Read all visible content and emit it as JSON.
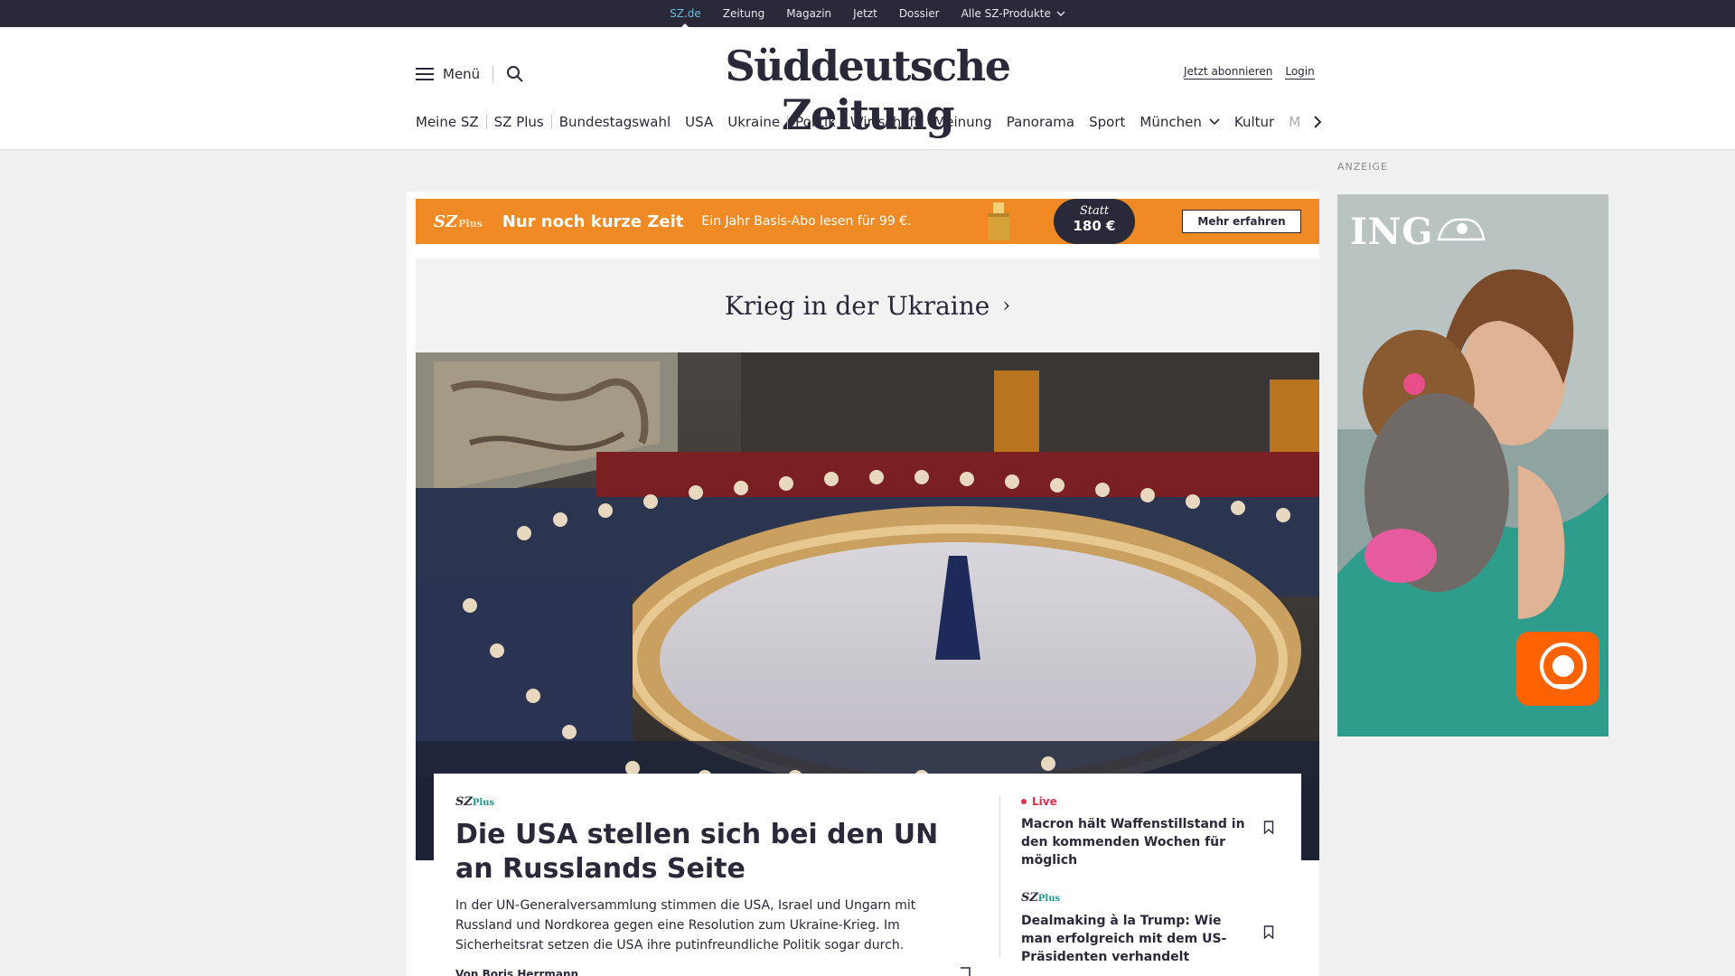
{
  "topbar": {
    "items": [
      {
        "label": "SZ.de",
        "active": true
      },
      {
        "label": "Zeitung"
      },
      {
        "label": "Magazin"
      },
      {
        "label": "Jetzt"
      },
      {
        "label": "Dossier"
      },
      {
        "label": "Alle SZ-Produkte",
        "icon": "chevron-down-icon"
      }
    ]
  },
  "header": {
    "menu_label": "Menü",
    "menu_icon": "hamburger-icon",
    "search_icon": "search-icon",
    "logo": "Süddeutsche Zeitung",
    "subscribe": "Jetzt abonnieren",
    "login": "Login"
  },
  "nav": {
    "items": [
      "Meine SZ",
      "SZ Plus",
      "Bundestagswahl",
      "USA",
      "Ukraine",
      "Politik",
      "Wirtschaft",
      "Meinung",
      "Panorama",
      "Sport",
      "München",
      "Kultur",
      "M"
    ],
    "more_icon": "chevron-right-icon"
  },
  "promo": {
    "brand": "SZ",
    "brand_plus": "Plus",
    "headline": "Nur noch kurze Zeit",
    "sub": "Ein Jahr Basis-Abo lesen für 99 €.",
    "badge_top": "Statt",
    "badge_price": "180 €",
    "cta": "Mehr erfahren",
    "color": "#f08a24"
  },
  "section": {
    "title": "Krieg in der Ukraine",
    "chevron": "›"
  },
  "lead": {
    "brand": "SZ",
    "brand_plus": "Plus",
    "headline": "Die USA stellen sich bei den UN an Russlands Seite",
    "teaser": "In der UN-Generalversammlung stimmen die USA, Israel und Ungarn mit Russland und Nordkorea gegen eine Resolution zum Ukraine-Krieg. Im Sicherheitsrat setzen die USA ihre putinfreundliche Politik sogar durch.",
    "author": "Von Boris Herrmann"
  },
  "side": {
    "live_label": "Live",
    "item1": "Macron hält Waffenstillstand in den kommenden Wochen für möglich",
    "brand": "SZ",
    "brand_plus": "Plus",
    "item2": "Dealmaking à la Trump: Wie man erfolgreich mit dem US-Präsidenten verhandelt"
  },
  "ad": {
    "label": "ANZEIGE",
    "brand": "ING",
    "color": "#ff6200"
  }
}
